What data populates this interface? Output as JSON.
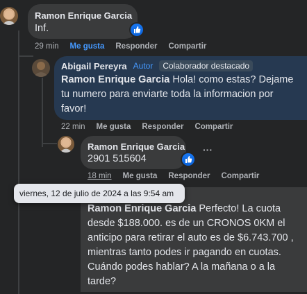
{
  "comments": [
    {
      "author": "Ramon Enrique Garcia",
      "text": "Inf.",
      "time": "29 min",
      "actions": [
        "Me gusta",
        "Responder",
        "Compartir"
      ]
    },
    {
      "author": "Abigail Pereyra",
      "badges": [
        "Autor",
        "Colaborador destacado"
      ],
      "mention": "Ramon Enrique Garcia",
      "text_lines": [
        "Hola! como estas? Dejame",
        "tu numero para enviarte toda la informacion por",
        "favor!"
      ],
      "time": "22 min",
      "actions": [
        "Me gusta",
        "Responder",
        "Compartir"
      ]
    },
    {
      "author": "Ramon Enrique Garcia",
      "text": "2901 515604",
      "time": "18 min",
      "actions": [
        "Me gusta",
        "Responder",
        "Compartir"
      ],
      "more": "···"
    },
    {
      "mention": "Ramon Enrique Garcia",
      "text_lines": [
        " Perfecto! La cuota",
        "desde $188.000. es de un CRONOS 0KM el",
        "anticipo para retirar el auto es de $6.743.700 ,",
        "mientras tanto podes ir pagando en cuotas.",
        "Cuándo podes hablar? A la mañana o a la",
        "tarde?"
      ]
    }
  ],
  "tooltip": "viernes, 12 de julio de 2024 a las 9:54 am",
  "colors": {
    "background": "#242526",
    "bubble": "#3a3b3c",
    "highlight_bubble": "#263951",
    "link": "#4599ff",
    "like": "#1877f2"
  }
}
